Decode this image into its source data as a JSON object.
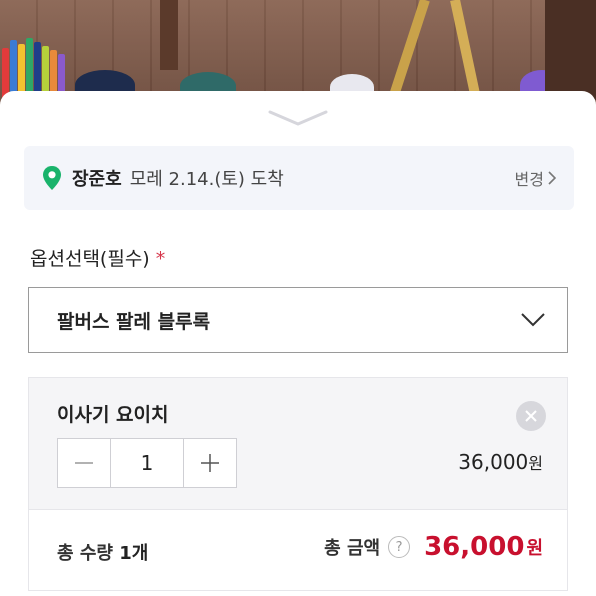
{
  "delivery": {
    "recipient": "장준호",
    "eta": "모레 2.14.(토) 도착",
    "change_label": "변경"
  },
  "option": {
    "label": "옵션선택(필수)",
    "required_mark": "*",
    "selected": "팔버스 팔레 블루록"
  },
  "item": {
    "name": "이사기 요이치",
    "quantity": "1",
    "price": "36,000",
    "currency": "원"
  },
  "summary": {
    "total_qty_label": "총 수량",
    "total_qty_value": "1개",
    "total_amount_label": "총 금액",
    "help": "?",
    "total_amount": "36,000",
    "currency": "원"
  },
  "colors": {
    "accent": "#c8102e",
    "pin": "#19b36b",
    "required": "#d6354a"
  },
  "icons": {
    "pin": "location-pin-icon",
    "change": "chevron-right-icon",
    "select": "chevron-down-icon",
    "remove": "close-icon",
    "minus": "minus-icon",
    "plus": "plus-icon",
    "help": "question-icon"
  }
}
